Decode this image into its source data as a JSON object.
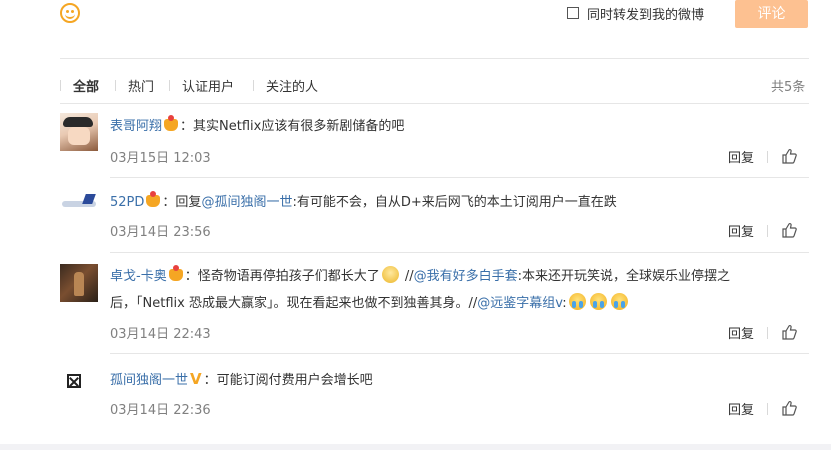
{
  "composer": {
    "emoji_icon": "smiley-face-icon",
    "forward_label": "同时转发到我的微博",
    "forward_checked": false,
    "comment_button": "评论",
    "accent_color": "#fdc191"
  },
  "filters": {
    "tabs": [
      {
        "label": "全部",
        "active": true
      },
      {
        "label": "热门",
        "active": false
      },
      {
        "label": "认证用户",
        "active": false
      },
      {
        "label": "关注的人",
        "active": false
      }
    ],
    "total": "共5条"
  },
  "comments": [
    {
      "username": "表哥阿翔",
      "badge": "crown-member-icon",
      "colon": "：",
      "text": "其实Netflix应该有很多新剧储备的吧",
      "time": "03月15日 12:03",
      "reply": "回复"
    },
    {
      "username": "52PD",
      "badge": "crown-member-icon",
      "colon": "：",
      "reply_prefix": "回复",
      "mention": "@孤间独阁一世",
      "text": ":有可能不会，自从D+来后网飞的本土订阅用户一直在跌",
      "time": "03月14日 23:56",
      "reply": "回复"
    },
    {
      "username": "卓戈-卡奥",
      "badge": "crown-member-icon",
      "colon": "：",
      "text_a": "怪奇物语再停拍孩子们都长大了",
      "sep1": " //",
      "mention1": "@我有好多白手套",
      "text_b": ":本来还开玩笑说，全球娱乐业停摆之",
      "text_c": "后，「Netflix 恐成最大赢家」。现在看起来也做不到独善其身。//",
      "mention2": "@远鉴字幕组v",
      "text_d": ":",
      "time": "03月14日 22:43",
      "reply": "回复"
    },
    {
      "username": "孤间独阁一世",
      "badge": "v-verified-icon",
      "badge_text": "V",
      "colon": "：",
      "text": "可能订阅付费用户会增长吧",
      "time": "03月14日 22:36",
      "reply": "回复"
    }
  ]
}
